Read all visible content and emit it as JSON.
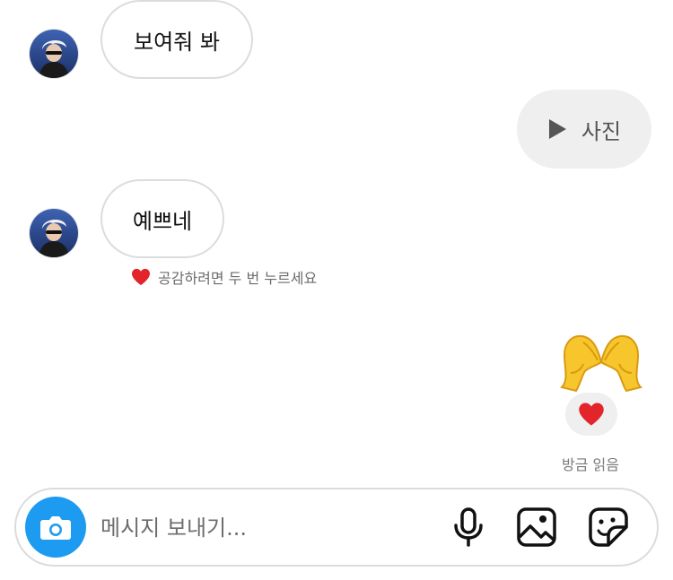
{
  "messages": [
    {
      "sender": "other",
      "text": "보여줘 봐"
    },
    {
      "sender": "me",
      "type": "media",
      "label": "사진",
      "icon": "play-icon"
    },
    {
      "sender": "other",
      "text": "예쁘네",
      "hint": "공감하려면 두 번 누르세요"
    },
    {
      "sender": "me",
      "type": "emoji",
      "emoji": "heart-hands-emoji",
      "reaction": "❤️"
    }
  ],
  "status": {
    "read_receipt": "방금 읽음"
  },
  "composer": {
    "placeholder": "메시지 보내기...",
    "icons": [
      "camera-icon",
      "microphone-icon",
      "image-icon",
      "sticker-icon"
    ]
  },
  "colors": {
    "accent": "#1d9bf0",
    "heart": "#e3242b",
    "bubble_out": "#efefef",
    "bubble_border": "#dcdcdc"
  }
}
